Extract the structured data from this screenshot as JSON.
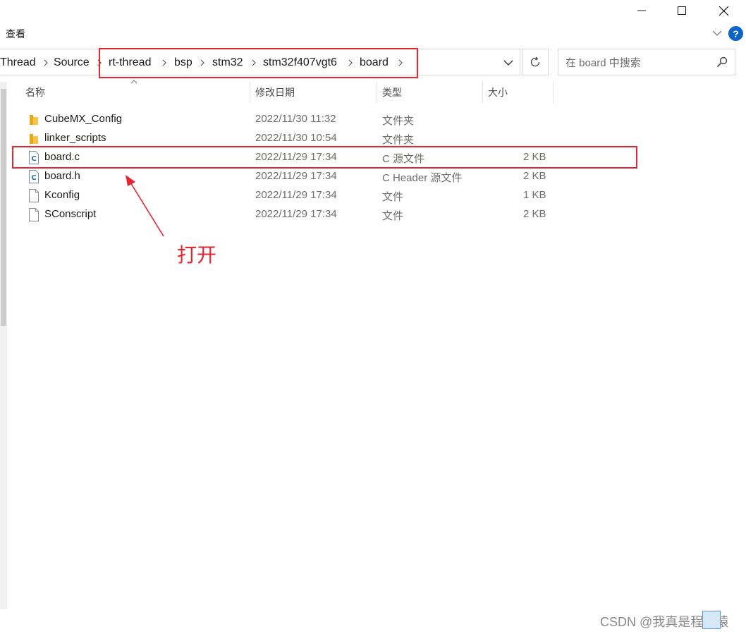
{
  "window": {
    "controls": [
      "minimize",
      "maximize",
      "close"
    ]
  },
  "ribbon": {
    "tab_view": "查看",
    "help_label": "?"
  },
  "address_bar": {
    "crumbs": [
      "Thread",
      "Source",
      "rt-thread",
      "bsp",
      "stm32",
      "stm32f407vgt6",
      "board"
    ]
  },
  "search": {
    "placeholder": "在 board 中搜索"
  },
  "columns": {
    "name": "名称",
    "modified": "修改日期",
    "type": "类型",
    "size": "大小"
  },
  "files": [
    {
      "name": "CubeMX_Config",
      "modified": "2022/11/30 11:32",
      "type": "文件夹",
      "size": "",
      "icon": "folder-icon"
    },
    {
      "name": "linker_scripts",
      "modified": "2022/11/30 10:54",
      "type": "文件夹",
      "size": "",
      "icon": "folder-icon"
    },
    {
      "name": "board.c",
      "modified": "2022/11/29 17:34",
      "type": "C 源文件",
      "size": "2 KB",
      "icon": "c-source-file-icon"
    },
    {
      "name": "board.h",
      "modified": "2022/11/29 17:34",
      "type": "C Header 源文件",
      "size": "2 KB",
      "icon": "c-header-file-icon"
    },
    {
      "name": "Kconfig",
      "modified": "2022/11/29 17:34",
      "type": "文件",
      "size": "1 KB",
      "icon": "file-icon"
    },
    {
      "name": "SConscript",
      "modified": "2022/11/29 17:34",
      "type": "文件",
      "size": "2 KB",
      "icon": "file-icon"
    }
  ],
  "annotation": {
    "text": "打开",
    "color": "#e8262f"
  },
  "watermark": "CSDN @我真是程序猿"
}
